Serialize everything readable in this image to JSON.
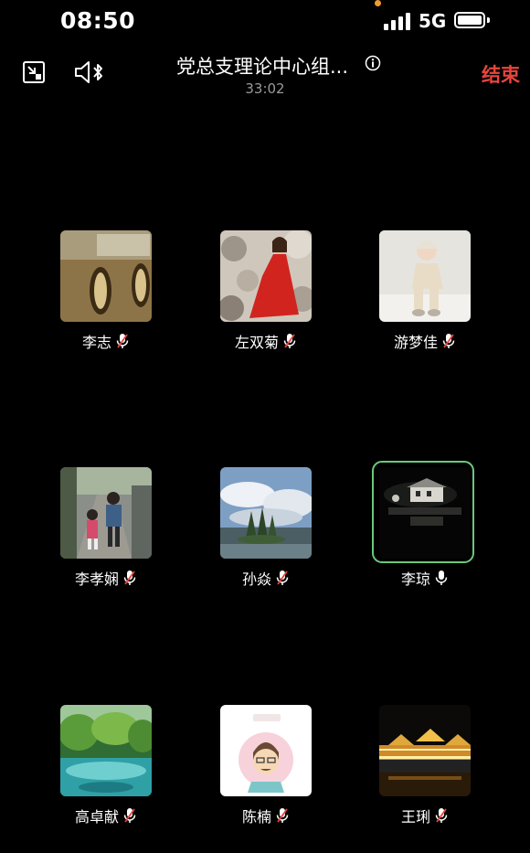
{
  "status_bar": {
    "time": "08:50",
    "network": "5G"
  },
  "header": {
    "title": "党总支理论中心组...",
    "duration": "33:02",
    "end_label": "结束"
  },
  "participants": [
    {
      "name": "李志",
      "mic": "muted"
    },
    {
      "name": "左双菊",
      "mic": "muted"
    },
    {
      "name": "游梦佳",
      "mic": "muted"
    },
    {
      "name": "李孝娴",
      "mic": "muted"
    },
    {
      "name": "孙焱",
      "mic": "muted"
    },
    {
      "name": "李琼",
      "mic": "on",
      "active_speaker": true
    },
    {
      "name": "高卓献",
      "mic": "muted"
    },
    {
      "name": "陈楠",
      "mic": "muted"
    },
    {
      "name": "王琍",
      "mic": "muted"
    }
  ],
  "colors": {
    "accent_end": "#e8453c",
    "active_border": "#6cc87c",
    "background": "#000000"
  }
}
